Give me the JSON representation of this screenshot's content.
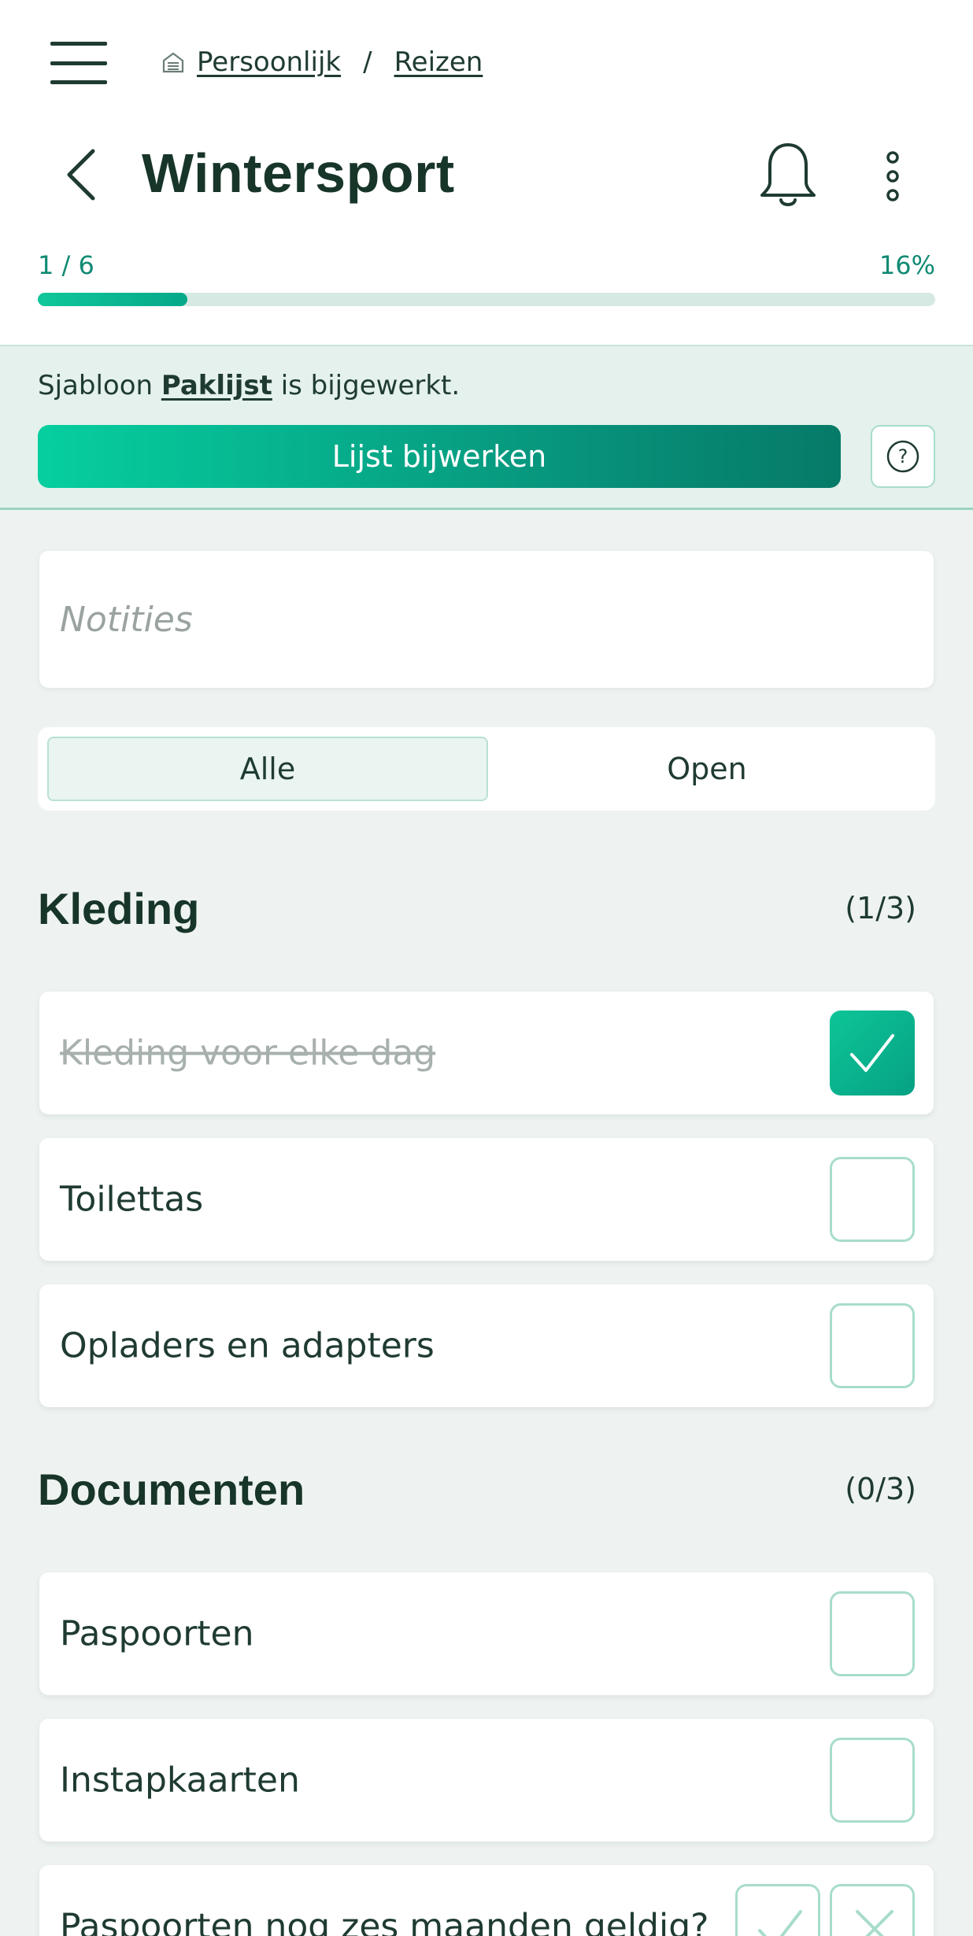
{
  "breadcrumb": {
    "items": [
      "Persoonlijk",
      "Reizen"
    ],
    "separator": "/"
  },
  "page": {
    "title": "Wintersport"
  },
  "progress": {
    "count_text": "1 / 6",
    "percent_text": "16%",
    "fraction": 0.1667
  },
  "banner": {
    "text_prefix": "Sjabloon",
    "template_name": "Paklijst",
    "text_suffix": "is bijgewerkt.",
    "button_label": "Lijst bijwerken",
    "help_glyph": "?"
  },
  "notes": {
    "placeholder": "Notities"
  },
  "filter": {
    "options": [
      "Alle",
      "Open"
    ],
    "selected": "Alle"
  },
  "sections": [
    {
      "title": "Kleding",
      "count": "(1/3)",
      "items": [
        {
          "label": "Kleding voor elke dag",
          "checked": true
        },
        {
          "label": "Toilettas",
          "checked": false
        },
        {
          "label": "Opladers en adapters",
          "checked": false
        }
      ]
    },
    {
      "title": "Documenten",
      "count": "(0/3)",
      "items": [
        {
          "label": "Paspoorten",
          "checked": false
        },
        {
          "label": "Instapkaarten",
          "checked": false
        },
        {
          "label": "Paspoorten nog zes maanden geldig?",
          "checked": false
        }
      ]
    }
  ],
  "colors": {
    "accent": "#06b893",
    "accent_dark": "#067a68",
    "text": "#173528"
  },
  "icons": [
    "menu-icon",
    "home-icon",
    "back-icon",
    "bell-icon",
    "more-icon",
    "help-icon",
    "check-icon",
    "cross-icon"
  ]
}
